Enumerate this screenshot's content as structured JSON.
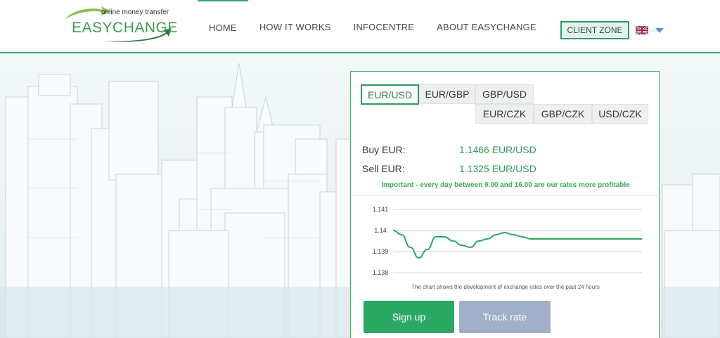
{
  "logo": {
    "tagline": "online money transfer",
    "word_left": "EASY",
    "word_right": "CHANGE"
  },
  "nav": {
    "items": [
      {
        "label": "HOME"
      },
      {
        "label": "HOW IT WORKS"
      },
      {
        "label": "INFOCENTRE"
      },
      {
        "label": "ABOUT EASYCHANGE"
      }
    ],
    "active_index": 0
  },
  "client_zone": {
    "label": "CLIENT ZONE"
  },
  "language": {
    "flag": "uk-flag-icon"
  },
  "widget": {
    "tabs": [
      {
        "label": "EUR/USD",
        "active": true
      },
      {
        "label": "EUR/GBP",
        "active": false
      },
      {
        "label": "GBP/USD",
        "active": false
      },
      {
        "label": "EUR/CZK",
        "active": false
      },
      {
        "label": "GBP/CZK",
        "active": false
      },
      {
        "label": "USD/CZK",
        "active": false
      }
    ],
    "buy_label": "Buy EUR:",
    "buy_value": "1.1466 EUR/USD",
    "sell_label": "Sell EUR:",
    "sell_value": "1.1325 EUR/USD",
    "important": "Important - every day between 9.00 and 16.00 are our rates more profitable",
    "chart_note": "The chart shows the development of exchange rates over the past 24 hours",
    "signup_label": "Sign up",
    "track_label": "Track rate"
  },
  "colors": {
    "accent": "#2ba863",
    "accent_dark": "#2e9a62",
    "track_button": "#9fb0c8"
  },
  "chart_data": {
    "type": "line",
    "title": "",
    "xlabel": "",
    "ylabel": "",
    "ylim": [
      1.138,
      1.141
    ],
    "yticks": [
      "1.141",
      "1.14",
      "1.139",
      "1.138"
    ],
    "grid": true,
    "series": [
      {
        "values": [
          1.14,
          1.1398,
          1.1392,
          1.1387,
          1.1391,
          1.1397,
          1.1397,
          1.1395,
          1.1393,
          1.1392,
          1.1395,
          1.1396,
          1.1398,
          1.1399,
          1.1398,
          1.1397,
          1.1396,
          1.1396,
          1.1396,
          1.1396,
          1.1396,
          1.1396,
          1.1396,
          1.1396,
          1.1396,
          1.1396,
          1.1396,
          1.1396,
          1.1396,
          1.1396
        ]
      }
    ]
  }
}
